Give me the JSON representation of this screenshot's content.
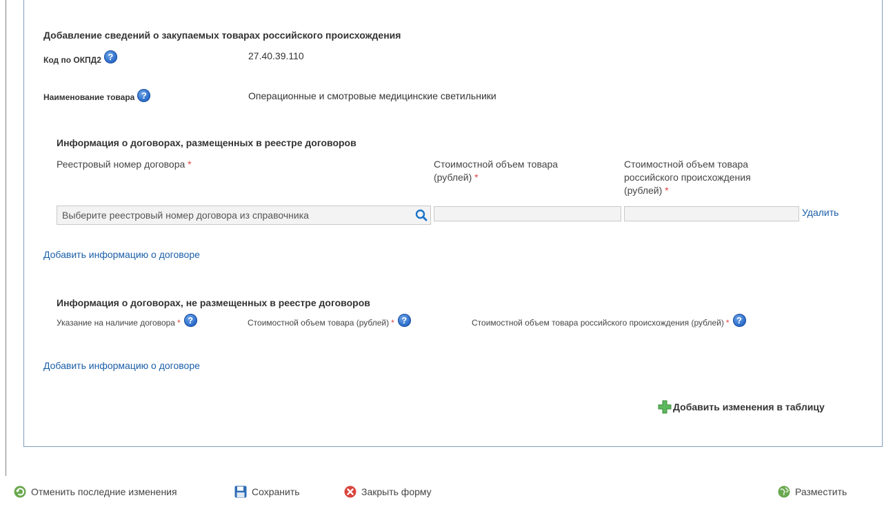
{
  "header": {
    "title": "Добавление сведений о закупаемых товарах российского происхождения"
  },
  "fields": {
    "okpd_label": "Код по ОКПД2",
    "okpd_value": "27.40.39.110",
    "name_label": "Наименование товара",
    "name_value": "Операционные и смотровые медицинские светильники"
  },
  "registered": {
    "title": "Информация о договорах, размещенных в реестре договоров",
    "col_reg_number": "Реестровый номер договора",
    "col_cost_line1": "Стоимостной объем товара",
    "col_cost_line2": "(рублей)",
    "col_cost_ru_line1": "Стоимостной объем товара",
    "col_cost_ru_line2": "российского происхождения",
    "col_cost_ru_line3": "(рублей)",
    "search_placeholder": "Выберите реестровый номер договора из справочника",
    "cost_value": "",
    "cost_ru_value": "",
    "delete_label": "Удалить",
    "add_label": "Добавить информацию о договоре"
  },
  "unregistered": {
    "title": "Информация о договорах, не размещенных в реестре договоров",
    "col_contract": "Указание на наличие договора",
    "col_cost": "Стоимостной объем товара (рублей)",
    "col_cost_ru": "Стоимостной объем товара российского происхождения (рублей)",
    "add_label": "Добавить информацию о договоре"
  },
  "add_changes_label": "Добавить изменения в таблицу",
  "required_mark": "*",
  "help_glyph": "?",
  "toolbar": {
    "undo_label": "Отменить последние изменения",
    "save_label": "Сохранить",
    "close_label": "Закрыть форму",
    "publish_label": "Разместить"
  },
  "colors": {
    "link": "#1a5ea8",
    "required": "#e04040",
    "help_icon": "#2e6fcc",
    "frame": "#7f9db9"
  },
  "icons": {
    "help": "help-icon",
    "search": "search-icon",
    "add": "plus-icon",
    "undo": "undo-icon",
    "save": "floppy-icon",
    "close": "close-icon",
    "publish": "globe-icon"
  }
}
